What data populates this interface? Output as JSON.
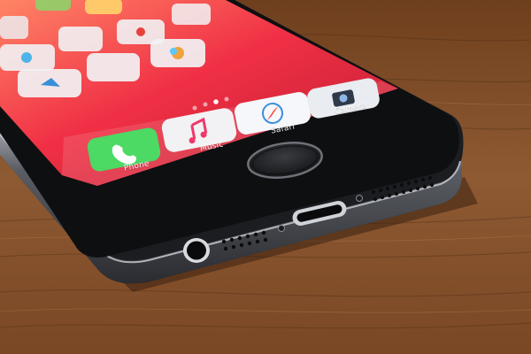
{
  "photo": {
    "subject": "smartphone-on-wooden-table",
    "colors": {
      "table": "#8a5430",
      "table_dark": "#5a3318",
      "wallpaper_top": "#ff6a55",
      "wallpaper_bottom": "#c8102e",
      "phone_body": "#2a2c31",
      "phone_edge": "#7d8088"
    }
  },
  "screen": {
    "dock": {
      "apps": [
        {
          "label": "Phone",
          "icon": "phone-icon",
          "color": "#4cd964"
        },
        {
          "label": "Music",
          "icon": "music-icon",
          "color": "#f2f2f4"
        },
        {
          "label": "Safari",
          "icon": "compass-icon",
          "color": "#f5f7fb"
        },
        {
          "label": "Camera",
          "icon": "camera-icon",
          "color": "#e9ecf0"
        }
      ]
    },
    "page_dots": 4,
    "active_page": 1
  }
}
